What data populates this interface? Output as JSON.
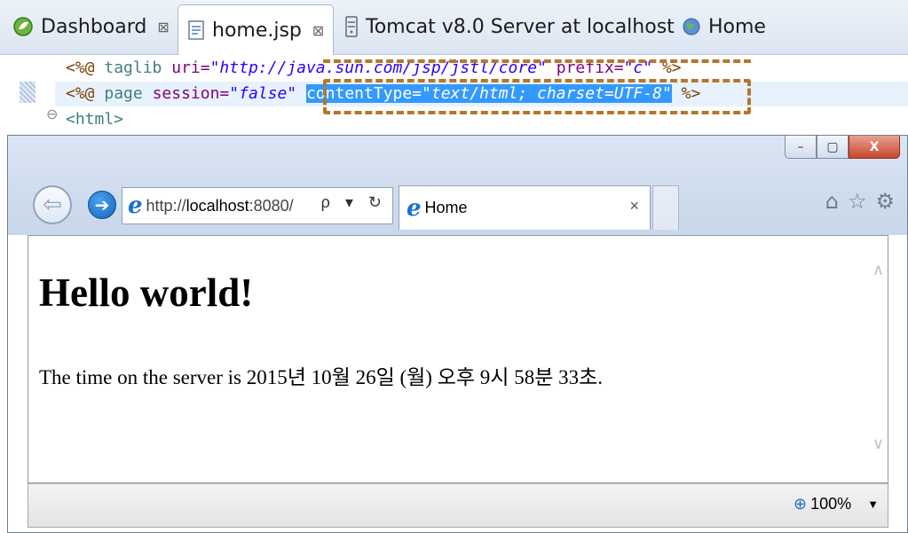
{
  "tabs": {
    "dashboard": {
      "label": "Dashboard",
      "close": "⊠"
    },
    "home_jsp": {
      "label": "home.jsp",
      "close": "⊠"
    },
    "tomcat": {
      "label": "Tomcat v8.0 Server at localhost"
    },
    "home": {
      "label": "Home"
    }
  },
  "code": {
    "line1": {
      "open": "<%@",
      "kw": "taglib",
      "attr1": "uri=",
      "val1": "\"http://java.sun.com/jsp/jstl/core\"",
      "attr2": "prefix=",
      "val2": "\"c\"",
      "close": "%>"
    },
    "line2": {
      "open": "<%@",
      "kw": "page",
      "attr1": "session=",
      "val1": "\"false\"",
      "attr2": "contentType=",
      "val2": "\"text/html; charset=UTF-8\"",
      "close": "%>"
    },
    "line3": {
      "fold": "⊖",
      "tag": "<html>"
    }
  },
  "browser": {
    "window_buttons": {
      "minimize": "–",
      "restore": "▢",
      "close": "X"
    },
    "address_prefix": "http://",
    "address_host": "localhost",
    "address_suffix": ":8080/",
    "address_controls": "ρ ▾ ↻",
    "tab_title": "Home",
    "tab_close": "×",
    "page": {
      "heading": "Hello world!",
      "text": "The time on the server is 2015년 10월 26일 (월) 오후 9시 58분 33초."
    },
    "zoom": "100%"
  },
  "colors": {
    "selection": "#3399ff",
    "highlight_box": "#b5762b",
    "ie_accent": "#1b6fd3"
  }
}
